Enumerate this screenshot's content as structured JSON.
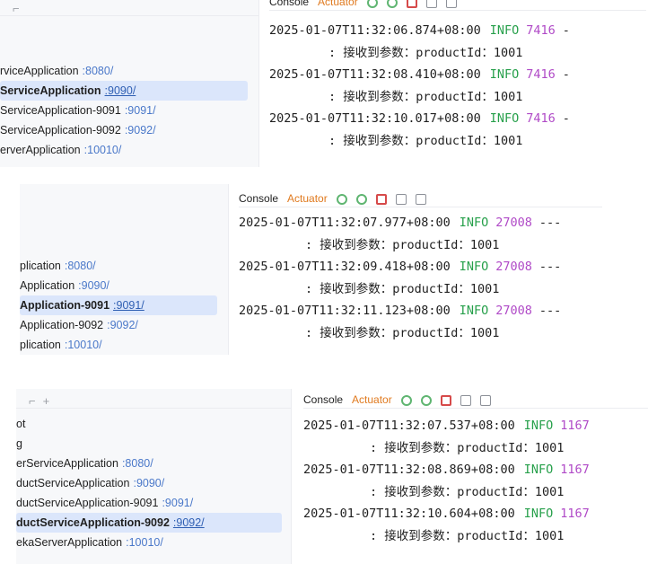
{
  "colors": {
    "info": "#27a04b",
    "pid": "#b04ac7",
    "port": "#4a78c9",
    "selection": "#dbe6fb"
  },
  "toolbar": {
    "console_tab": "Console",
    "actuator_tab": "Actuator"
  },
  "panels": [
    {
      "tree": [
        {
          "name": "rviceApplication",
          "port": ":8080/"
        },
        {
          "name": "ServiceApplication",
          "port": ":9090/"
        },
        {
          "name": "ServiceApplication-9091",
          "port": ":9091/"
        },
        {
          "name": "ServiceApplication-9092",
          "port": ":9092/"
        },
        {
          "name": "erverApplication",
          "port": ":10010/"
        }
      ],
      "logs": [
        {
          "ts": "2025-01-07T11:32:06.874+08:00",
          "level": "INFO",
          "pid": "7416",
          "tail": "-",
          "msg": ": 接收到参数：productId：1001"
        },
        {
          "ts": "2025-01-07T11:32:08.410+08:00",
          "level": "INFO",
          "pid": "7416",
          "tail": "-",
          "msg": ": 接收到参数：productId：1001"
        },
        {
          "ts": "2025-01-07T11:32:10.017+08:00",
          "level": "INFO",
          "pid": "7416",
          "tail": "-",
          "msg": ": 接收到参数：productId：1001"
        }
      ]
    },
    {
      "tree": [
        {
          "name": "plication",
          "port": ":8080/"
        },
        {
          "name": "Application",
          "port": ":9090/"
        },
        {
          "name": "Application-9091",
          "port": ":9091/"
        },
        {
          "name": "Application-9092",
          "port": ":9092/"
        },
        {
          "name": "plication",
          "port": ":10010/"
        }
      ],
      "logs": [
        {
          "ts": "2025-01-07T11:32:07.977+08:00",
          "level": "INFO",
          "pid": "27008",
          "tail": "---",
          "msg": ": 接收到参数：productId：1001"
        },
        {
          "ts": "2025-01-07T11:32:09.418+08:00",
          "level": "INFO",
          "pid": "27008",
          "tail": "---",
          "msg": ": 接收到参数：productId：1001"
        },
        {
          "ts": "2025-01-07T11:32:11.123+08:00",
          "level": "INFO",
          "pid": "27008",
          "tail": "---",
          "msg": ": 接收到参数：productId：1001"
        }
      ]
    },
    {
      "tree_head": "+",
      "tree": [
        {
          "name": "ot",
          "port": ""
        },
        {
          "name": "g",
          "port": ""
        },
        {
          "name": "erServiceApplication",
          "port": ":8080/"
        },
        {
          "name": "ductServiceApplication",
          "port": ":9090/"
        },
        {
          "name": "ductServiceApplication-9091",
          "port": ":9091/"
        },
        {
          "name": "ductServiceApplication-9092",
          "port": ":9092/"
        },
        {
          "name": "ekaServerApplication",
          "port": ":10010/"
        }
      ],
      "logs": [
        {
          "ts": "2025-01-07T11:32:07.537+08:00",
          "level": "INFO",
          "pid": "1167",
          "tail": "",
          "msg": ": 接收到参数：productId：1001"
        },
        {
          "ts": "2025-01-07T11:32:08.869+08:00",
          "level": "INFO",
          "pid": "1167",
          "tail": "",
          "msg": ": 接收到参数：productId：1001"
        },
        {
          "ts": "2025-01-07T11:32:10.604+08:00",
          "level": "INFO",
          "pid": "1167",
          "tail": "",
          "msg": ": 接收到参数：productId：1001"
        }
      ]
    }
  ]
}
